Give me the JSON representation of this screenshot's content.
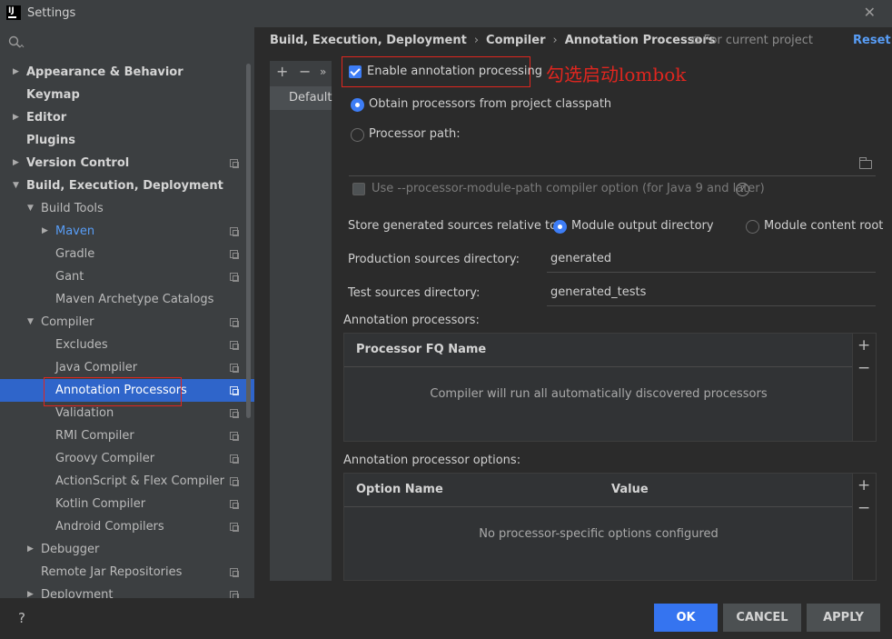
{
  "window": {
    "title": "Settings",
    "logo_text": "IJ",
    "close_glyph": "✕"
  },
  "sidebar": {
    "tree": [
      {
        "label": "Appearance & Behavior",
        "arrow": "▶",
        "level": 0,
        "bold": true
      },
      {
        "label": "Keymap",
        "level": 0,
        "bold": true
      },
      {
        "label": "Editor",
        "arrow": "▶",
        "level": 0,
        "bold": true
      },
      {
        "label": "Plugins",
        "level": 0,
        "bold": true
      },
      {
        "label": "Version Control",
        "arrow": "▶",
        "level": 0,
        "bold": true,
        "copy": true
      },
      {
        "label": "Build, Execution, Deployment",
        "arrow": "▼",
        "level": 0,
        "bold": true
      },
      {
        "label": "Build Tools",
        "arrow": "▼",
        "level": 1
      },
      {
        "label": "Maven",
        "arrow": "▶",
        "level": 2,
        "copy": true,
        "link": true
      },
      {
        "label": "Gradle",
        "level": 2,
        "copy": true
      },
      {
        "label": "Gant",
        "level": 2,
        "copy": true
      },
      {
        "label": "Maven Archetype Catalogs",
        "level": 2
      },
      {
        "label": "Compiler",
        "arrow": "▼",
        "level": 1,
        "copy": true
      },
      {
        "label": "Excludes",
        "level": 2,
        "copy": true
      },
      {
        "label": "Java Compiler",
        "level": 2,
        "copy": true
      },
      {
        "label": "Annotation Processors",
        "level": 2,
        "copy": true,
        "selected": true
      },
      {
        "label": "Validation",
        "level": 2,
        "copy": true
      },
      {
        "label": "RMI Compiler",
        "level": 2,
        "copy": true
      },
      {
        "label": "Groovy Compiler",
        "level": 2,
        "copy": true
      },
      {
        "label": "ActionScript & Flex Compiler",
        "level": 2,
        "copy": true
      },
      {
        "label": "Kotlin Compiler",
        "level": 2,
        "copy": true
      },
      {
        "label": "Android Compilers",
        "level": 2,
        "copy": true
      },
      {
        "label": "Debugger",
        "arrow": "▶",
        "level": 1
      },
      {
        "label": "Remote Jar Repositories",
        "level": 1,
        "copy": true
      },
      {
        "label": "Deployment",
        "arrow": "▶",
        "level": 1,
        "copy": true
      }
    ]
  },
  "breadcrumb": {
    "items": [
      "Build, Execution, Deployment",
      "Compiler",
      "Annotation Processors"
    ],
    "separator": "›",
    "scope": "For current project",
    "scope_icon": "⧉",
    "reset": "Reset"
  },
  "profiles": {
    "add": "+",
    "remove": "−",
    "more": "»",
    "default_label": "Default"
  },
  "form": {
    "enable_processing": "Enable annotation processing",
    "annotation_note": "勾选启动lombok",
    "obtain_from_classpath": "Obtain processors from project classpath",
    "processor_path": "Processor path:",
    "use_module_path": "Use --processor-module-path compiler option (for Java 9 and later)",
    "help_glyph": "?",
    "store_relative_label": "Store generated sources relative to:",
    "module_output": "Module output directory",
    "module_content": "Module content root",
    "production_label": "Production sources directory:",
    "production_value": "generated",
    "test_label": "Test sources directory:",
    "test_value": "generated_tests"
  },
  "processors_table": {
    "section": "Annotation processors:",
    "column": "Processor FQ Name",
    "empty": "Compiler will run all automatically discovered processors",
    "add": "+",
    "remove": "−"
  },
  "options_table": {
    "section": "Annotation processor options:",
    "columns": [
      "Option Name",
      "Value"
    ],
    "empty": "No processor-specific options configured",
    "add": "+",
    "remove": "−"
  },
  "footer": {
    "help": "?",
    "ok": "OK",
    "cancel": "CANCEL",
    "apply": "APPLY"
  },
  "colors": {
    "accent": "#3574f0",
    "selection": "#2f65ca",
    "annotation_red": "#e0261f",
    "link": "#589df6"
  }
}
